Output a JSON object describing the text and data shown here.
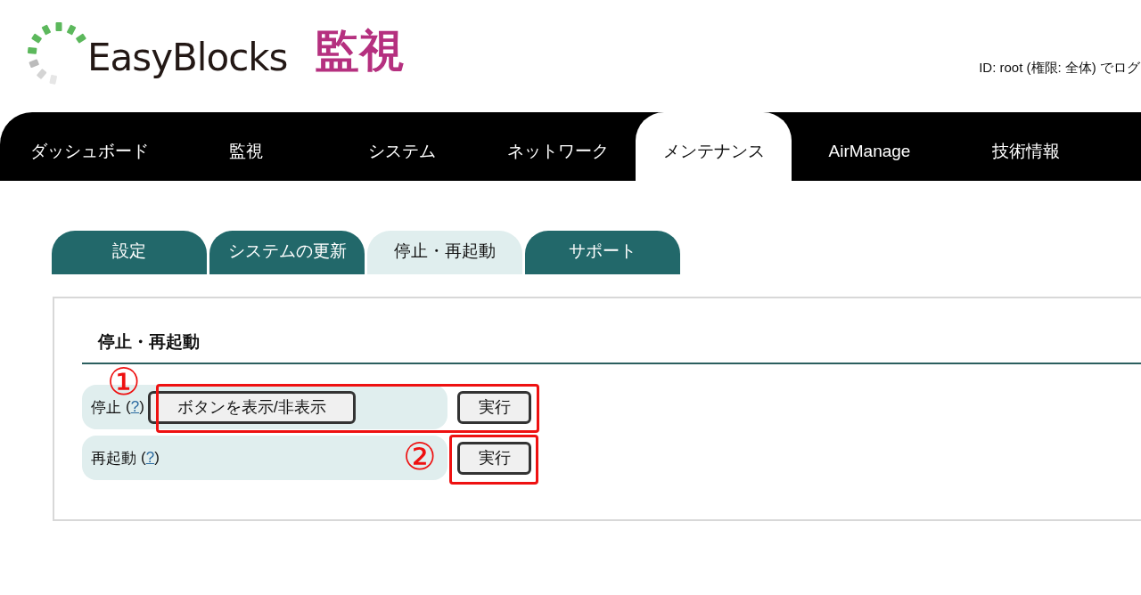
{
  "header": {
    "logo_text": "EasyBlocks",
    "section_title": "監視",
    "login_info": "ID: root (権限: 全体) でログ"
  },
  "nav": [
    {
      "label": "ダッシュボード",
      "selected": false
    },
    {
      "label": "監視",
      "selected": false
    },
    {
      "label": "システム",
      "selected": false
    },
    {
      "label": "ネットワーク",
      "selected": false
    },
    {
      "label": "メンテナンス",
      "selected": true
    },
    {
      "label": "AirManage",
      "selected": false
    },
    {
      "label": "技術情報",
      "selected": false
    }
  ],
  "subtabs": [
    {
      "label": "設定",
      "selected": false
    },
    {
      "label": "システムの更新",
      "selected": false
    },
    {
      "label": "停止・再起動",
      "selected": true
    },
    {
      "label": "サポート",
      "selected": false
    }
  ],
  "panel": {
    "title": "停止・再起動",
    "rows": [
      {
        "label": "停止",
        "paren_open": "(",
        "help": "?",
        "paren_close": ")",
        "toggle_button": "ボタンを表示/非表示",
        "action_button": "実行"
      },
      {
        "label": "再起動",
        "paren_open": "(",
        "help": "?",
        "paren_close": ")",
        "action_button": "実行"
      }
    ]
  },
  "annotations": [
    {
      "number": "①"
    },
    {
      "number": "②"
    }
  ]
}
